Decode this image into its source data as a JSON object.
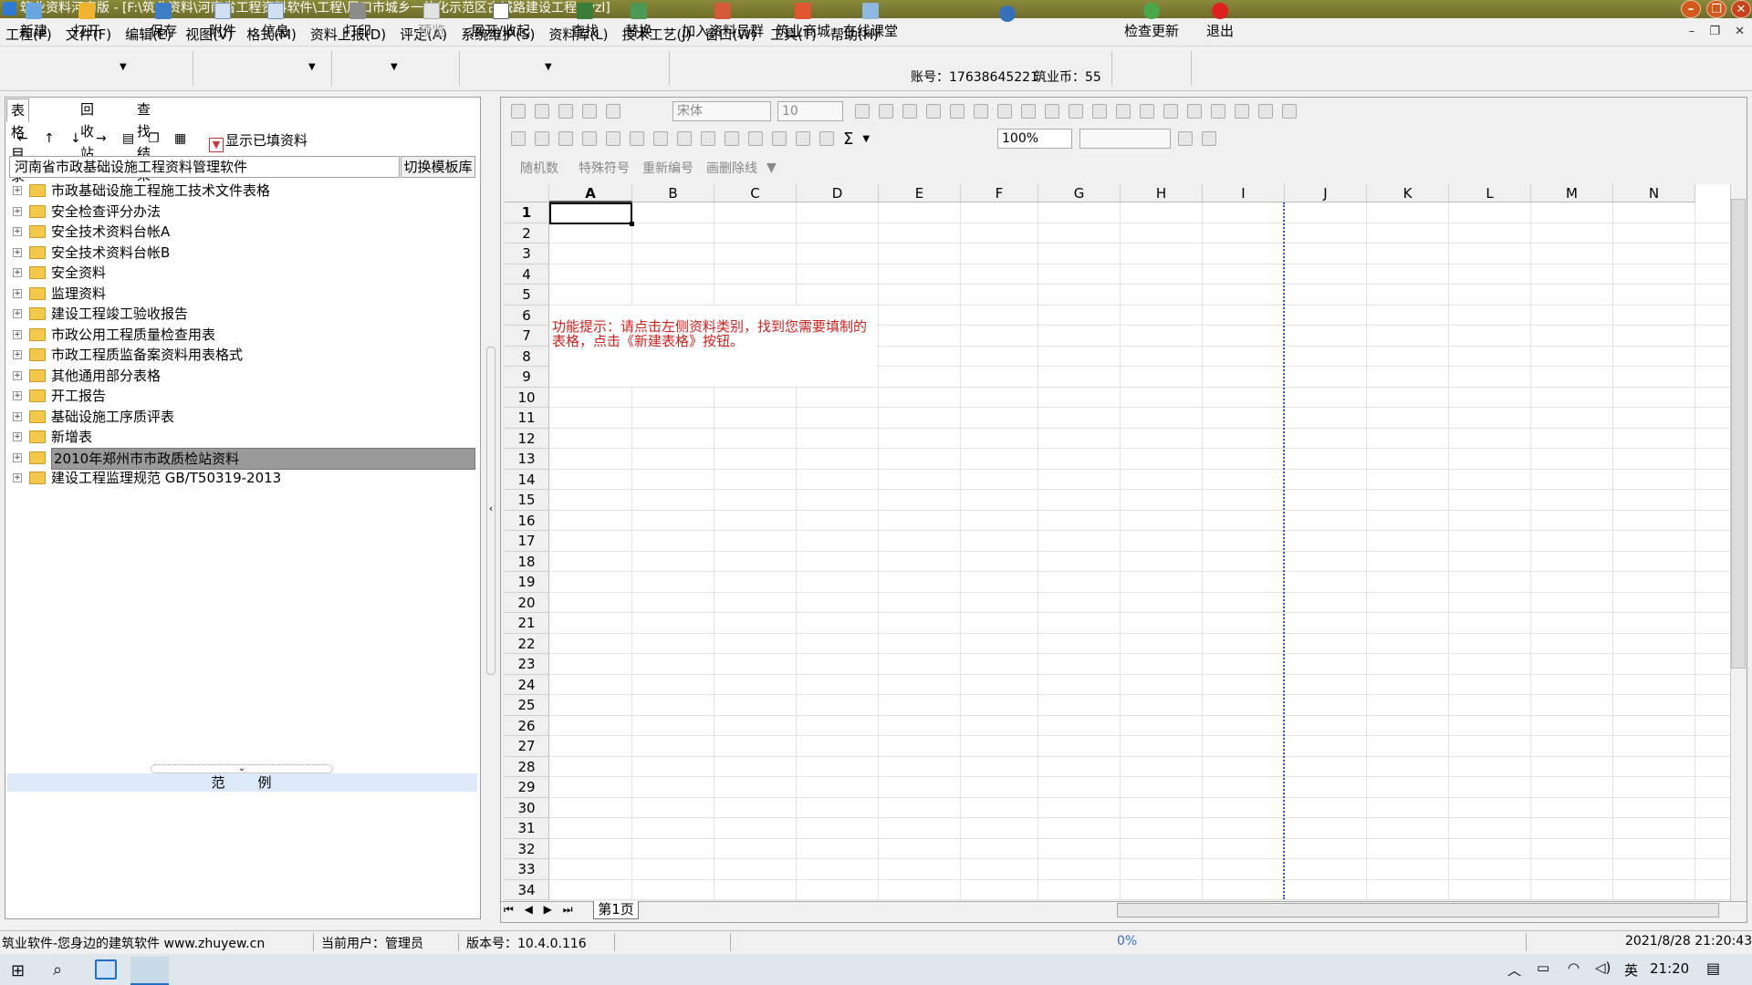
{
  "titlebar": {
    "title": "筑业资料河南版 - [F:\\筑业资料\\河南省工程资料软件\\工程\\周口市城乡一体化示范区古城路建设工程.zyzl]"
  },
  "menu": [
    "工程(P)",
    "文件(F)",
    "编辑(E)",
    "视图(V)",
    "格式(M)",
    "资料上报(D)",
    "评定(A)",
    "系统维护(S)",
    "资料库(L)",
    "技术工艺(J)",
    "窗口(W)",
    "工具(T)",
    "帮助(H)"
  ],
  "toolbar": {
    "new": "新建",
    "open": "打开",
    "save": "保存",
    "attach": "附件",
    "info": "信息",
    "print": "打印",
    "preview": "预览",
    "expand": "展开/收起",
    "find": "查找",
    "replace": "替换",
    "join_group": "加入资料员群",
    "mall": "筑业商城",
    "online_class": "在线课堂",
    "account": "账号：17638645221",
    "coins": "筑业币：55",
    "check_update": "检查更新",
    "exit": "退出"
  },
  "left": {
    "tabs": [
      "表格目录",
      "回收站",
      "查找结果"
    ],
    "show_filled": "显示已填资料",
    "software_name": "河南省市政基础设施工程资料管理软件",
    "switch_lib": "切换模板库",
    "tree": [
      "市政基础设施工程施工技术文件表格",
      "安全检查评分办法",
      "安全技术资料台帐A",
      "安全技术资料台帐B",
      "安全资料",
      "监理资料",
      "建设工程竣工验收报告",
      "市政公用工程质量检查用表",
      "市政工程质监备案资料用表格式",
      "其他通用部分表格",
      "开工报告",
      "基础设施工序质评表",
      "新增表",
      "2010年郑州市市政质检站资料",
      "建设工程监理规范 GB/T50319-2013"
    ],
    "selected_index": 13,
    "example_header": "范　　例"
  },
  "format": {
    "font": "宋体",
    "size": "10",
    "zoom": "100%",
    "random": "随机数",
    "special_char": "特殊符号",
    "renumber": "重新编号",
    "strike": "画删除线"
  },
  "sheet": {
    "columns": [
      "A",
      "B",
      "C",
      "D",
      "E",
      "F",
      "G",
      "H",
      "I",
      "J",
      "K",
      "L",
      "M",
      "N"
    ],
    "rows": [
      "1",
      "2",
      "3",
      "4",
      "5",
      "6",
      "7",
      "8",
      "9",
      "10",
      "11",
      "12",
      "13",
      "14",
      "15",
      "16",
      "17",
      "18",
      "19",
      "20",
      "21",
      "22",
      "23",
      "24",
      "25",
      "26",
      "27",
      "28",
      "29",
      "30",
      "31",
      "32",
      "33",
      "34"
    ],
    "hint": "功能提示：请点击左侧资料类别，找到您需要填制的表格，点击《新建表格》按钮。",
    "tab": "第1页"
  },
  "status": {
    "company": "筑业软件-您身边的建筑软件 www.zhuyew.cn",
    "user": "当前用户：管理员",
    "version": "版本号：10.4.0.116",
    "progress": "0%",
    "datetime": "2021/8/28 21:20:43"
  },
  "taskbar": {
    "ime": "英",
    "time": "21:20"
  },
  "colors": {
    "hint": "#d4201c",
    "selected_tree": "#9a9a9a",
    "pagebreak": "#3a57c4"
  }
}
